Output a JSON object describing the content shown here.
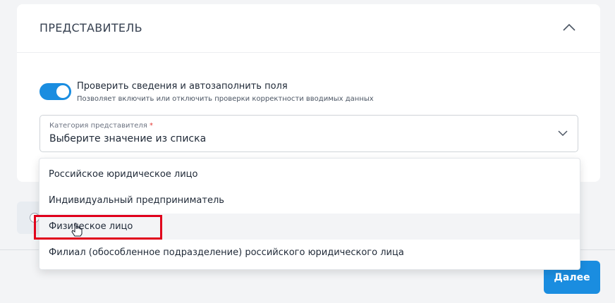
{
  "section": {
    "title": "ПРЕДСТАВИТЕЛЬ",
    "collapse_icon": "chevron-up-icon"
  },
  "toggle": {
    "state": "on",
    "label": "Проверить сведения и автозаполнить поля",
    "hint": "Позволяет включить или отключить проверки корректности вводимых данных"
  },
  "category_select": {
    "label": "Категория представителя",
    "required_mark": "*",
    "placeholder_value": "Выберите значение из списка",
    "icon": "chevron-down-icon",
    "options": [
      {
        "label": "Российское юридическое лицо"
      },
      {
        "label": "Индивидуальный предприниматель"
      },
      {
        "label": "Физическое лицо"
      },
      {
        "label": "Филиал (обособленное подразделение) российского юридического лица"
      }
    ],
    "hovered_index": 2
  },
  "footer": {
    "next_label": "Далее"
  },
  "colors": {
    "accent": "#1a8de0",
    "highlight": "#e0001b"
  }
}
